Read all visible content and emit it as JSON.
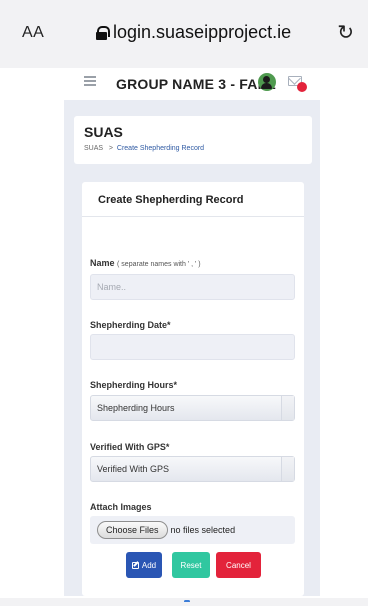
{
  "browser": {
    "text_size_label": "AA",
    "url": "login.suaseipproject.ie"
  },
  "header": {
    "group_title": "GROUP NAME 3 -  FAR1"
  },
  "page_header": {
    "title": "SUAS",
    "breadcrumb_root": "SUAS",
    "breadcrumb_separator": ">",
    "breadcrumb_current": "Create Shepherding Record"
  },
  "form": {
    "card_title": "Create Shepherding Record",
    "name_label": "Name",
    "name_hint": "( separate names with ' , ' )",
    "name_placeholder": "Name..",
    "date_label": "Shepherding Date*",
    "date_value": "",
    "hours_label": "Shepherding Hours*",
    "hours_selected": "Shepherding Hours",
    "gps_label": "Verified With GPS*",
    "gps_selected": "Verified With GPS",
    "images_label": "Attach Images",
    "choose_files_label": "Choose Files",
    "no_files_text": "no files selected"
  },
  "buttons": {
    "add_label": "Add",
    "reset_label": "Reset",
    "cancel_label": "Cancel"
  },
  "colors": {
    "add": "#2a56b4",
    "reset": "#30c7a0",
    "cancel": "#e3233b",
    "notification_badge": "#e3233b"
  }
}
